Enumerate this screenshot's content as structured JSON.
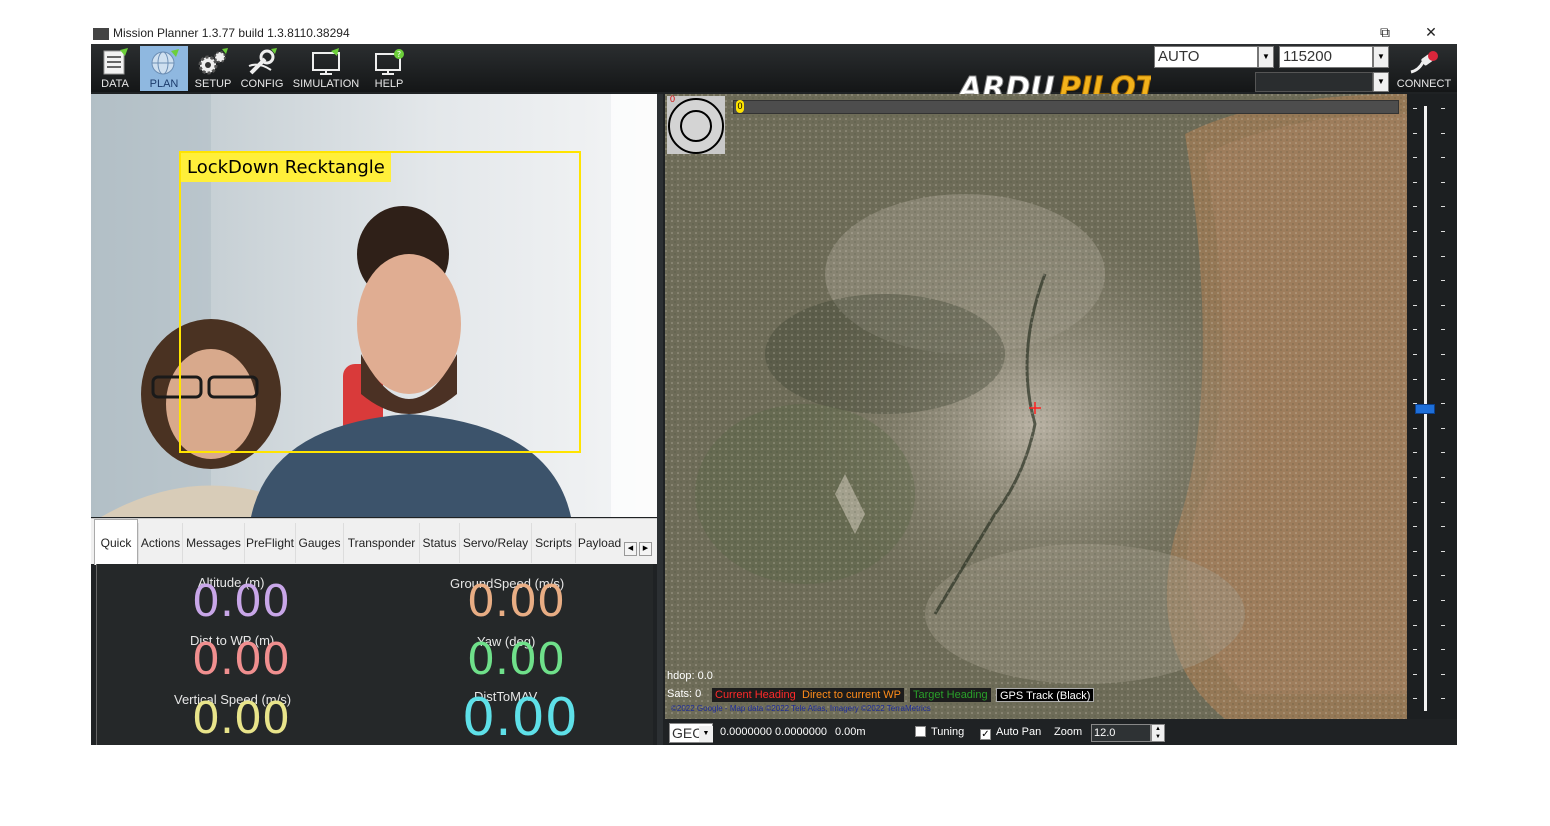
{
  "window": {
    "title": "Mission Planner 1.3.77 build 1.3.8110.38294",
    "restore_glyph": "⧉",
    "close_glyph": "✕"
  },
  "toolbar": {
    "buttons": [
      {
        "label": "DATA",
        "icon": "data-icon"
      },
      {
        "label": "PLAN",
        "icon": "plan-globe-icon"
      },
      {
        "label": "SETUP",
        "icon": "setup-gears-icon"
      },
      {
        "label": "CONFIG",
        "icon": "config-wrench-icon"
      },
      {
        "label": "SIMULATION",
        "icon": "simulation-monitor-icon"
      },
      {
        "label": "HELP",
        "icon": "help-monitor-icon"
      }
    ],
    "active_button": "PLAN",
    "logo_text_left": "ARDU",
    "logo_text_right": "PILOT",
    "mode_select": "AUTO",
    "baud_select": "115200",
    "port_select": "",
    "connect_label": "CONNECT",
    "accent": "#8fb8e0"
  },
  "video": {
    "lock_label": "LockDown Recktangle",
    "lock_color": "#ffe400"
  },
  "tabs": {
    "items": [
      "Quick",
      "Actions",
      "Messages",
      "PreFlight",
      "Gauges",
      "Transponder",
      "Status",
      "Servo/Relay",
      "Scripts",
      "Payload"
    ],
    "active": "Quick"
  },
  "quick": {
    "metrics": [
      {
        "label": "Altitude (m)",
        "value": "0.00",
        "color": "#c8a6e8"
      },
      {
        "label": "GroundSpeed (m/s)",
        "value": "0.00",
        "color": "#e8ad84"
      },
      {
        "label": "Dist to WP (m)",
        "value": "0.00",
        "color": "#f08f8f"
      },
      {
        "label": "Yaw (deg)",
        "value": "0.00",
        "color": "#6fe08a"
      },
      {
        "label": "Vertical Speed (m/s)",
        "value": "0.00",
        "color": "#e8e48a"
      },
      {
        "label": "DistToMAV",
        "value": "0.00",
        "color": "#5ee0e8"
      }
    ]
  },
  "map": {
    "compass_value": "0",
    "progress_value": "0",
    "hdop": "hdop: 0.0",
    "sats": "Sats: 0",
    "legend": [
      {
        "label": "Current Heading",
        "color": "#ff2a2a"
      },
      {
        "label": "Direct to current WP",
        "color": "#ff8c1a"
      },
      {
        "label": "Target Heading",
        "color": "#2aa02a"
      },
      {
        "label": "GPS Track (Black)",
        "color": "#ffffff"
      }
    ],
    "attribution": "©2022 Google - Map data ©2022 Tele Atlas, Imagery ©2022 TerraMetrics"
  },
  "statusbar": {
    "coord_system": "GEC",
    "coords": "0.0000000 0.0000000",
    "altitude": "0.00m",
    "tuning_label": "Tuning",
    "tuning_checked": false,
    "autopan_label": "Auto Pan",
    "autopan_checked": true,
    "zoom_label": "Zoom",
    "zoom_value": "12.0"
  }
}
